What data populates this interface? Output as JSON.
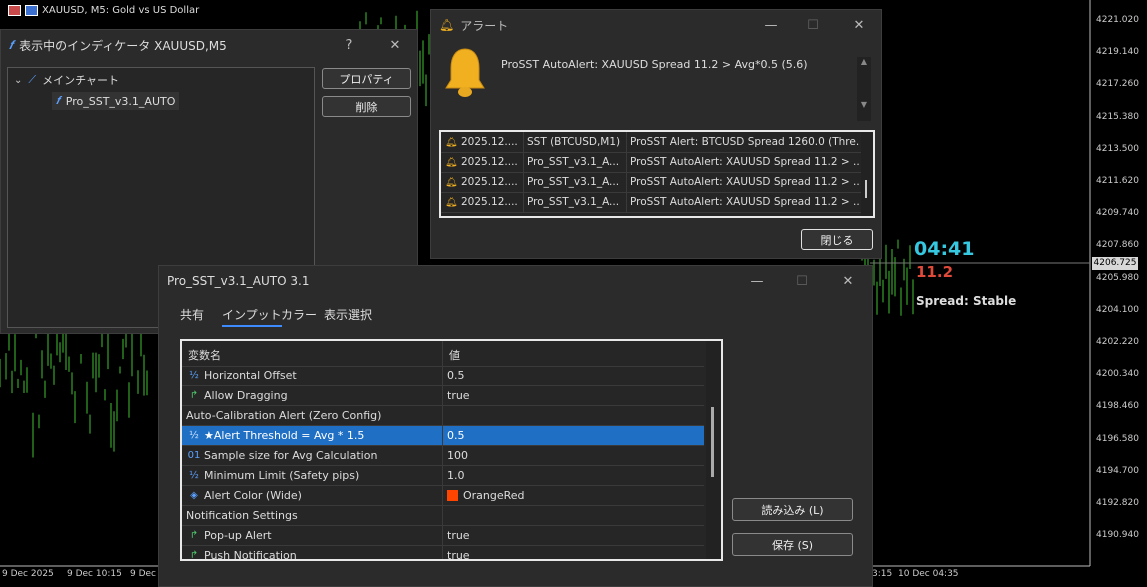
{
  "chart": {
    "symbol_title": "XAUUSD, M5:  Gold vs US Dollar",
    "price_labels": [
      "4221.020",
      "4219.140",
      "4217.260",
      "4215.380",
      "4213.500",
      "4211.620",
      "4209.740",
      "4207.860",
      "4205.980",
      "4204.100",
      "4202.220",
      "4200.340",
      "4198.460",
      "4196.580",
      "4194.700",
      "4192.820",
      "4190.940"
    ],
    "current_price": "4206.725",
    "time_labels": [
      "9 Dec 2025",
      "9 Dec 10:15",
      "9 Dec",
      "3:15",
      "10 Dec 04:35"
    ],
    "timer": "04:41",
    "spread_value": "11.2",
    "spread_status": "Spread: Stable",
    "colors": {
      "timer": "#35c8e0",
      "spread_value": "#e04a3a",
      "candles": "#3fbf2f"
    }
  },
  "indicators_window": {
    "title": "表示中のインディケータ XAUUSD,M5",
    "help": "?",
    "tree_root": "メインチャート",
    "tree_child": "Pro_SST_v3.1_AUTO",
    "properties_button": "プロパティ",
    "delete_button": "削除"
  },
  "alert_window": {
    "title": "アラート",
    "message": "ProSST AutoAlert: XAUUSD Spread 11.2 > Avg*0.5 (5.6)",
    "rows": [
      {
        "date": "2025.12....",
        "source": "SST (BTCUSD,M1)",
        "message": "ProSST Alert: BTCUSD Spread 1260.0 (Thre..."
      },
      {
        "date": "2025.12....",
        "source": "Pro_SST_v3.1_A...",
        "message": "ProSST AutoAlert: XAUUSD Spread 11.2 > ..."
      },
      {
        "date": "2025.12....",
        "source": "Pro_SST_v3.1_A...",
        "message": "ProSST AutoAlert: XAUUSD Spread 11.2 > ..."
      },
      {
        "date": "2025.12....",
        "source": "Pro_SST_v3.1_A...",
        "message": "ProSST AutoAlert: XAUUSD Spread 11.2 > ..."
      }
    ],
    "close_button": "閉じる",
    "bell_color": "#f0b020"
  },
  "props_window": {
    "title": "Pro_SST_v3.1_AUTO 3.1",
    "tabs": [
      "共有",
      "インプット",
      "カラー",
      "表示選択"
    ],
    "active_tab": "インプット",
    "col_name": "変数名",
    "col_value": "値",
    "rows": [
      {
        "icon": "½",
        "name": "Horizontal Offset",
        "value": "0.5"
      },
      {
        "icon": "↱",
        "name": "Allow Dragging",
        "value": "true"
      },
      {
        "icon": "",
        "name": "Auto-Calibration Alert (Zero Config)",
        "value": ""
      },
      {
        "icon": "½",
        "name": "★Alert Threshold = Avg * 1.5",
        "value": "0.5"
      },
      {
        "icon": "01",
        "name": "Sample size for Avg Calculation",
        "value": "100"
      },
      {
        "icon": "½",
        "name": "Minimum Limit (Safety pips)",
        "value": "1.0"
      },
      {
        "icon": "◈",
        "name": "Alert Color (Wide)",
        "value": "OrangeRed"
      },
      {
        "icon": "",
        "name": "Notification Settings",
        "value": ""
      },
      {
        "icon": "↱",
        "name": "Pop-up Alert",
        "value": "true"
      },
      {
        "icon": "↱",
        "name": "Push Notification",
        "value": "true"
      }
    ],
    "alert_color_swatch": "#ff4500",
    "selection_color": "#1f6fc5",
    "load_button": "読み込み (L)",
    "save_button": "保存 (S)"
  }
}
